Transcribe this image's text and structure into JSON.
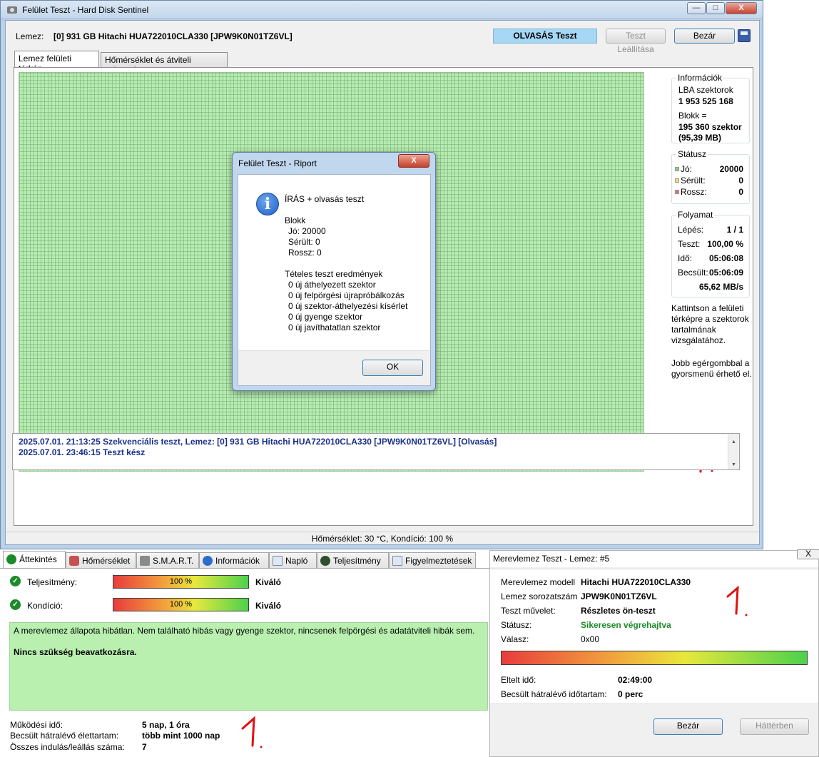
{
  "main_window": {
    "title": "Felület Teszt - Hard Disk Sentinel",
    "caption_buttons": {
      "minimize": "—",
      "maximize": "□",
      "close": "X"
    },
    "lemez_label": "Lemez:",
    "disk_name": "[0] 931 GB  Hitachi HUA722010CLA330 [JPW9K0N01TZ6VL]",
    "test_mode": "OLVASÁS Teszt",
    "stop_button": "Teszt Leállítása",
    "close_button": "Bezár",
    "tabs": [
      {
        "label": "Lemez felületi térkép",
        "active": true
      },
      {
        "label": "Hőmérséklet és átviteli sebesség",
        "active": false
      }
    ],
    "info": {
      "title": "Információk",
      "lba_label": "LBA szektorok",
      "lba_value": "1 953 525 168",
      "block_label": "Blokk =",
      "block_value": "195 360 szektor",
      "block_size": "(95,39 MB)"
    },
    "status": {
      "title": "Státusz",
      "rows": [
        {
          "label": "Jó:",
          "value": "20000",
          "color": "#7fd07f"
        },
        {
          "label": "Sérült:",
          "value": "0",
          "color": "#e8e070"
        },
        {
          "label": "Rossz:",
          "value": "0",
          "color": "#e07070"
        }
      ]
    },
    "progress": {
      "title": "Folyamat",
      "rows": [
        {
          "label": "Lépés:",
          "value": "1 / 1"
        },
        {
          "label": "Teszt:",
          "value": "100,00 %"
        },
        {
          "label": "Idő:",
          "value": "05:06:08"
        },
        {
          "label": "Becsült:",
          "value": "05:06:09"
        }
      ],
      "speed": "65,62 MB/s"
    },
    "help1": "Kattintson a felületi térképre a szektorok tartalmának vizsgálatához.",
    "help2": "Jobb egérgombbal a gyorsmenü érhető el.",
    "log": [
      "2025.07.01.  21:13:25   Szekvenciális teszt, Lemez: [0] 931 GB  Hitachi HUA722010CLA330 [JPW9K0N01TZ6VL] [Olvasás]",
      "2025.07.01.  23:46:15   Teszt kész"
    ],
    "statusbar": "Hőmérséklet: 30  °C,  Kondíció: 100 %"
  },
  "report_dialog": {
    "title": "Felület Teszt - Riport",
    "close": "X",
    "heading": "ÍRÁS + olvasás teszt",
    "blokk_label": "Blokk",
    "blokk_lines": [
      "Jó: 20000",
      "Sérült: 0",
      "Rossz: 0"
    ],
    "results_label": "Tételes teszt eredmények",
    "result_lines": [
      "0 új áthelyezett szektor",
      "0 új felpörgési újrapróbálkozás",
      "0 új szektor-áthelyezési kísérlet",
      "0 új gyenge szektor",
      "0 új javíthatatlan szektor"
    ],
    "ok_button": "OK"
  },
  "overview": {
    "tabs": [
      {
        "label": "Áttekintés",
        "icon": "check-icon",
        "active": true
      },
      {
        "label": "Hőmérséklet",
        "icon": "thermometer-icon",
        "active": false
      },
      {
        "label": "S.M.A.R.T.",
        "icon": "smart-icon",
        "active": false
      },
      {
        "label": "Információk",
        "icon": "info-icon",
        "active": false
      },
      {
        "label": "Napló",
        "icon": "log-icon",
        "active": false
      },
      {
        "label": "Teljesítmény",
        "icon": "gauge-icon",
        "active": false
      },
      {
        "label": "Figyelmeztetések",
        "icon": "warning-icon",
        "active": false
      }
    ],
    "performance": {
      "label": "Teljesítmény:",
      "percent": 100,
      "bar_text": "100 %",
      "rating": "Kiváló"
    },
    "condition": {
      "label": "Kondíció:",
      "percent": 100,
      "bar_text": "100 %",
      "rating": "Kiváló"
    },
    "health_text": "A merevlemez állapota hibátlan. Nem található hibás vagy gyenge szektor, nincsenek felpörgési és adatátviteli hibák sem.",
    "health_action": "Nincs szükség beavatkozásra.",
    "stats": [
      {
        "label": "Működési idő:",
        "value": "5 nap, 1 óra"
      },
      {
        "label": "Becsült hátralévő élettartam:",
        "value": "több mint 1000 nap"
      },
      {
        "label": "Összes indulás/leállás száma:",
        "value": "7"
      }
    ]
  },
  "drive_test": {
    "title": "Merevlemez Teszt - Lemez: #5",
    "close": "X",
    "rows": [
      {
        "label": "Merevlemez modell",
        "value": "Hitachi HUA722010CLA330"
      },
      {
        "label": "Lemez sorozatszám",
        "value": "JPW9K0N01TZ6VL"
      },
      {
        "label": "Teszt művelet:",
        "value": "Részletes ön-teszt"
      },
      {
        "label": "Státusz:",
        "value": "Sikeresen végrehajtva"
      },
      {
        "label": "Válasz:",
        "value": "0x00"
      }
    ],
    "progress_percent": 100,
    "elapsed_label": "Eltelt idő:",
    "elapsed_value": "02:49:00",
    "remaining_label": "Becsült hátralévő időtartam:",
    "remaining_value": "0 perc",
    "close_button": "Bezár",
    "background_button": "Háttérben",
    "status_color": "#1d8a2a"
  }
}
